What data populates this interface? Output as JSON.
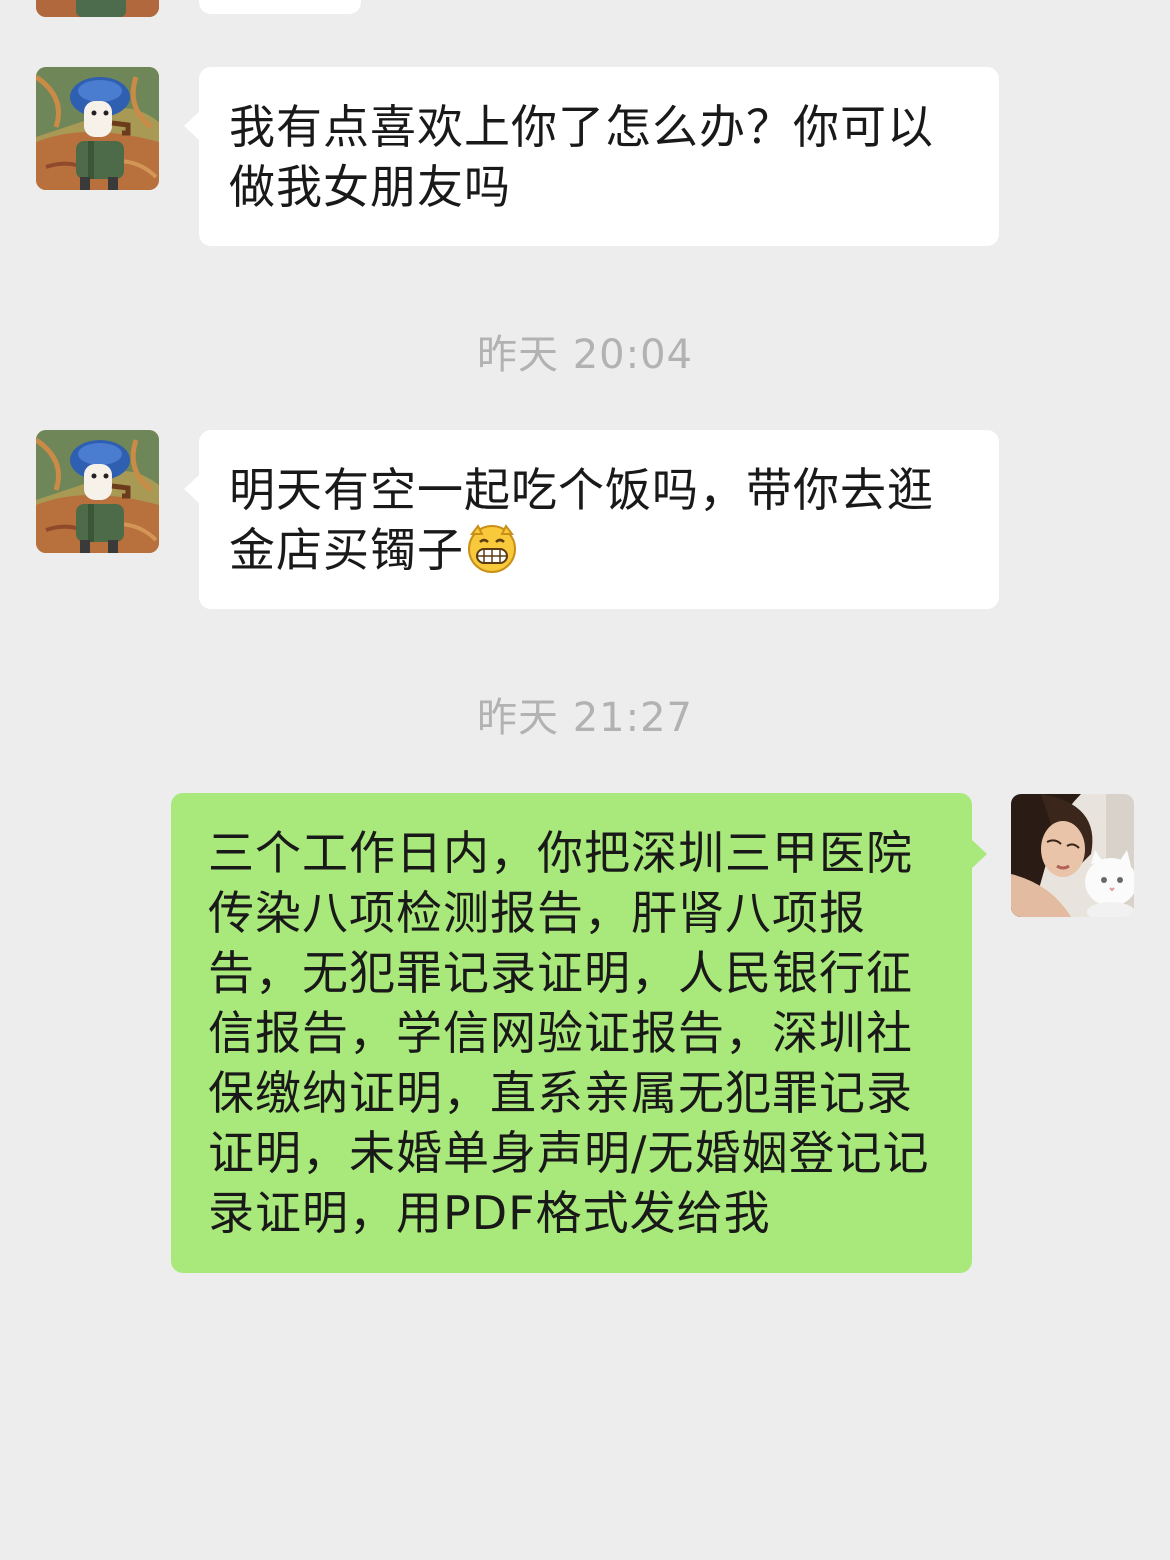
{
  "conversation": {
    "messages": [
      {
        "id": "msg-top-partial",
        "direction": "incoming",
        "text": ""
      },
      {
        "id": "msg-1",
        "direction": "incoming",
        "text": "我有点喜欢上你了怎么办？你可以做我女朋友吗"
      },
      {
        "id": "msg-2",
        "direction": "incoming",
        "text": "明天有空一起吃个饭吗，带你去逛金店买镯子",
        "emoji": "grinning-face-emoji"
      },
      {
        "id": "msg-3",
        "direction": "outgoing",
        "text": "三个工作日内，你把深圳三甲医院传染八项检测报告，肝肾八项报告，无犯罪记录证明，人民银行征信报告，学信网验证报告，深圳社保缴纳证明，直系亲属无犯罪记录证明，未婚单身声明/无婚姻登记记录证明，用PDF格式发给我"
      }
    ],
    "timestamps": [
      {
        "text": "昨天 20:04"
      },
      {
        "text": "昨天 21:27"
      }
    ]
  },
  "avatars": {
    "contact": "cartoon-man-with-pipe-avatar",
    "self": "woman-with-white-cat-avatar"
  },
  "colors": {
    "background": "#ededed",
    "incoming_bubble": "#ffffff",
    "outgoing_bubble": "#a9e87a",
    "timestamp_text": "#b2b2b2",
    "message_text": "#191919"
  }
}
